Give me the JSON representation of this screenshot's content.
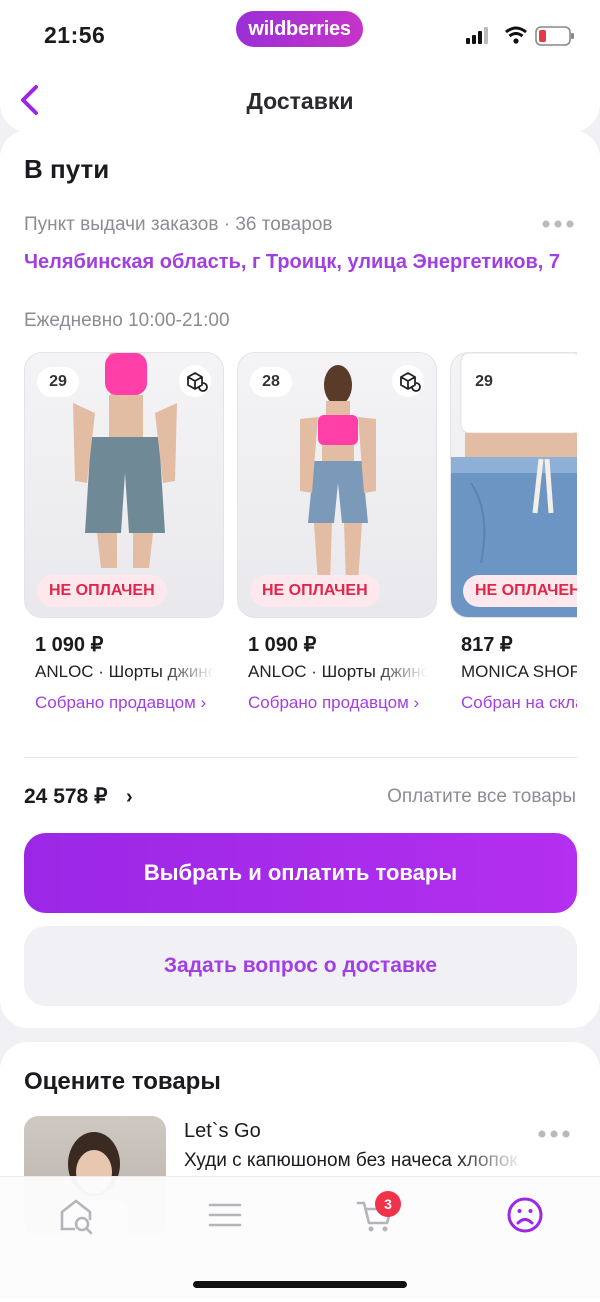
{
  "status_bar": {
    "time": "21:56",
    "brand": "wildberries"
  },
  "header": {
    "title": "Доставки"
  },
  "delivery": {
    "title": "В пути",
    "meta": "Пункт выдачи заказов · 36 товаров",
    "address": "Челябинская область, г Троицк, улица Энергетиков, 7",
    "hours": "Ежедневно 10:00-21:00",
    "products": [
      {
        "day": "29",
        "badge": "НЕ ОПЛАЧЕН",
        "price": "1 090 ₽",
        "name": "ANLOC · Шорты джинсовые",
        "status": "Собрано продавцом ›"
      },
      {
        "day": "28",
        "badge": "НЕ ОПЛАЧЕН",
        "price": "1 090 ₽",
        "name": "ANLOC · Шорты джинсовые",
        "status": "Собрано продавцом ›"
      },
      {
        "day": "29",
        "badge": "НЕ ОПЛАЧЕН",
        "price": "817 ₽",
        "name": "MONICA SHOP",
        "status": "Собран на складе"
      }
    ],
    "total": "24 578 ₽",
    "total_chevron": "›",
    "pay_hint": "Оплатите все товары",
    "primary_button": "Выбрать и оплатить товары",
    "secondary_button": "Задать вопрос о доставке"
  },
  "rate": {
    "title": "Оцените товары",
    "brand": "Let`s Go",
    "name": "Худи с капюшоном без начеса хлопок"
  },
  "tabbar": {
    "cart_badge": "3"
  },
  "colors": {
    "accent": "#a23fe2",
    "button": "#9b27e6",
    "unpaid_text": "#e0264b",
    "unpaid_bg": "#fde8ee",
    "badge": "#f0324a"
  },
  "icons": [
    "back-icon",
    "more-icon",
    "box-return-icon",
    "home-search-icon",
    "menu-icon",
    "cart-icon",
    "profile-icon"
  ]
}
